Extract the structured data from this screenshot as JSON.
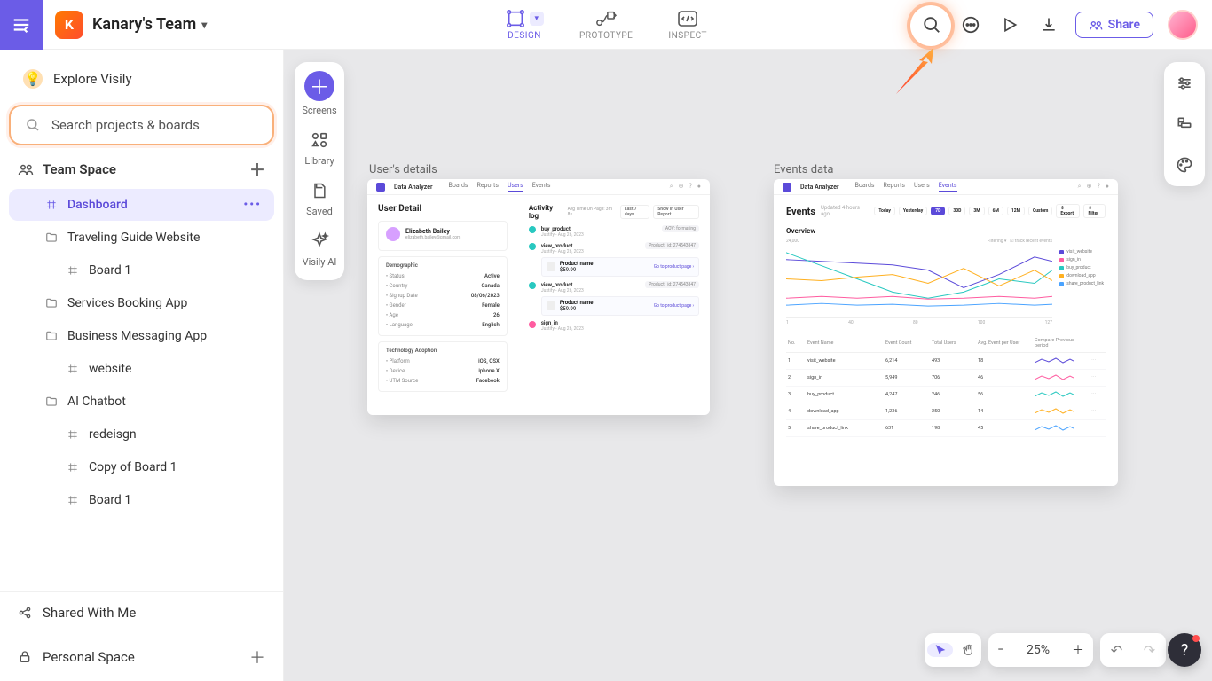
{
  "header": {
    "team_initial": "K",
    "team_name": "Kanary's Team",
    "nav": {
      "design": "DESIGN",
      "prototype": "PROTOTYPE",
      "inspect": "INSPECT"
    },
    "share": "Share"
  },
  "sidebar": {
    "explore": "Explore Visily",
    "search_placeholder": "Search projects & boards",
    "team_space": "Team Space",
    "items": [
      {
        "type": "board",
        "label": "Dashboard",
        "selected": true
      },
      {
        "type": "folder",
        "label": "Traveling Guide Website"
      },
      {
        "type": "board",
        "label": "Board 1",
        "lvl": 2
      },
      {
        "type": "folder",
        "label": "Services Booking App"
      },
      {
        "type": "folder",
        "label": "Business Messaging App"
      },
      {
        "type": "board",
        "label": "website",
        "lvl": 2
      },
      {
        "type": "folder",
        "label": "AI Chatbot"
      },
      {
        "type": "board",
        "label": "redeisgn",
        "lvl": 2
      },
      {
        "type": "board",
        "label": "Copy of Board 1",
        "lvl": 2
      },
      {
        "type": "board",
        "label": "Board 1",
        "lvl": 2
      }
    ],
    "shared": "Shared With Me",
    "personal": "Personal Space"
  },
  "toolbox": {
    "screens": "Screens",
    "library": "Library",
    "saved": "Saved",
    "ai": "Visily AI"
  },
  "canvas": {
    "frames": [
      {
        "label": "User's details"
      },
      {
        "label": "Events data"
      }
    ]
  },
  "user_detail": {
    "app": "Data Analyzer",
    "tabs": [
      "Boards",
      "Reports",
      "Users",
      "Events"
    ],
    "active_tab": "Users",
    "title": "User Detail",
    "profile_name": "Elizabeth Bailey",
    "profile_email": "elizabeth.bailey@gmail.com",
    "demo_title": "Demographic",
    "demo": [
      {
        "k": "Status",
        "v": "Active"
      },
      {
        "k": "Country",
        "v": "Canada"
      },
      {
        "k": "Signup Date",
        "v": "08/06/2023"
      },
      {
        "k": "Gender",
        "v": "Female"
      },
      {
        "k": "Age",
        "v": "26"
      },
      {
        "k": "Language",
        "v": "English"
      }
    ],
    "tech_title": "Technology Adoption",
    "tech": [
      {
        "k": "Platform",
        "v": "iOS, OSX"
      },
      {
        "k": "Device",
        "v": "iphone X"
      },
      {
        "k": "UTM Source",
        "v": "Facebook"
      }
    ],
    "al_title": "Activity log",
    "al_meta": "Avg Time On Page:  3m 8s",
    "al_filters": [
      "Last 7 days",
      "Show in User Report"
    ],
    "activities": [
      {
        "name": "buy_product",
        "date": "Justify - Aug 26, 2023",
        "tag": "AOV: formating"
      },
      {
        "name": "view_product",
        "date": "Justify - Aug 26, 2023",
        "tag": "Product _id: 274543847",
        "prod": "Product name",
        "price": "$59.99",
        "link": "Go to product page"
      },
      {
        "name": "view_product",
        "date": "Justify - Aug 26, 2023",
        "tag": "Product _id: 274543847",
        "prod": "Product name",
        "price": "$59.99",
        "link": "Go to product page"
      },
      {
        "name": "sign_in",
        "date": "Justify - Aug 26, 2023",
        "dot": "pink"
      }
    ]
  },
  "events": {
    "app": "Data Analyzer",
    "tabs": [
      "Boards",
      "Reports",
      "Users",
      "Events"
    ],
    "active_tab": "Events",
    "title": "Events",
    "subtitle": "Updated 4 hours ago",
    "range": [
      "Today",
      "Yesterday",
      "7D",
      "30D",
      "3M",
      "6M",
      "12M",
      "Custom"
    ],
    "range_active": "7D",
    "buttons": [
      "Export",
      "Filter"
    ],
    "overview": "Overview",
    "legend": [
      {
        "c": "#5b4ad9",
        "t": "visit_website"
      },
      {
        "c": "#ff5ca0",
        "t": "sign_in"
      },
      {
        "c": "#28c8c0",
        "t": "buy_product"
      },
      {
        "c": "#ffb020",
        "t": "download_app"
      },
      {
        "c": "#4aa3ff",
        "t": "share_product_link"
      }
    ],
    "table_head": [
      "No.",
      "Event Name",
      "Event Count",
      "Total Users",
      "Avg. Event per User",
      "Compare Previous period",
      ""
    ],
    "rows": [
      {
        "n": "1",
        "name": "visit_website",
        "count": "6,214",
        "users": "493",
        "avg": "18",
        "c": "#5b4ad9"
      },
      {
        "n": "2",
        "name": "sign_in",
        "count": "5,949",
        "users": "706",
        "avg": "46",
        "c": "#ff5ca0"
      },
      {
        "n": "3",
        "name": "buy_product",
        "count": "4,247",
        "users": "246",
        "avg": "56",
        "c": "#28c8c0"
      },
      {
        "n": "4",
        "name": "download_app",
        "count": "1,236",
        "users": "250",
        "avg": "14",
        "c": "#ffb020"
      },
      {
        "n": "5",
        "name": "share_product_link",
        "count": "631",
        "users": "198",
        "avg": "45",
        "c": "#4aa3ff"
      }
    ]
  },
  "zoom": "25%"
}
